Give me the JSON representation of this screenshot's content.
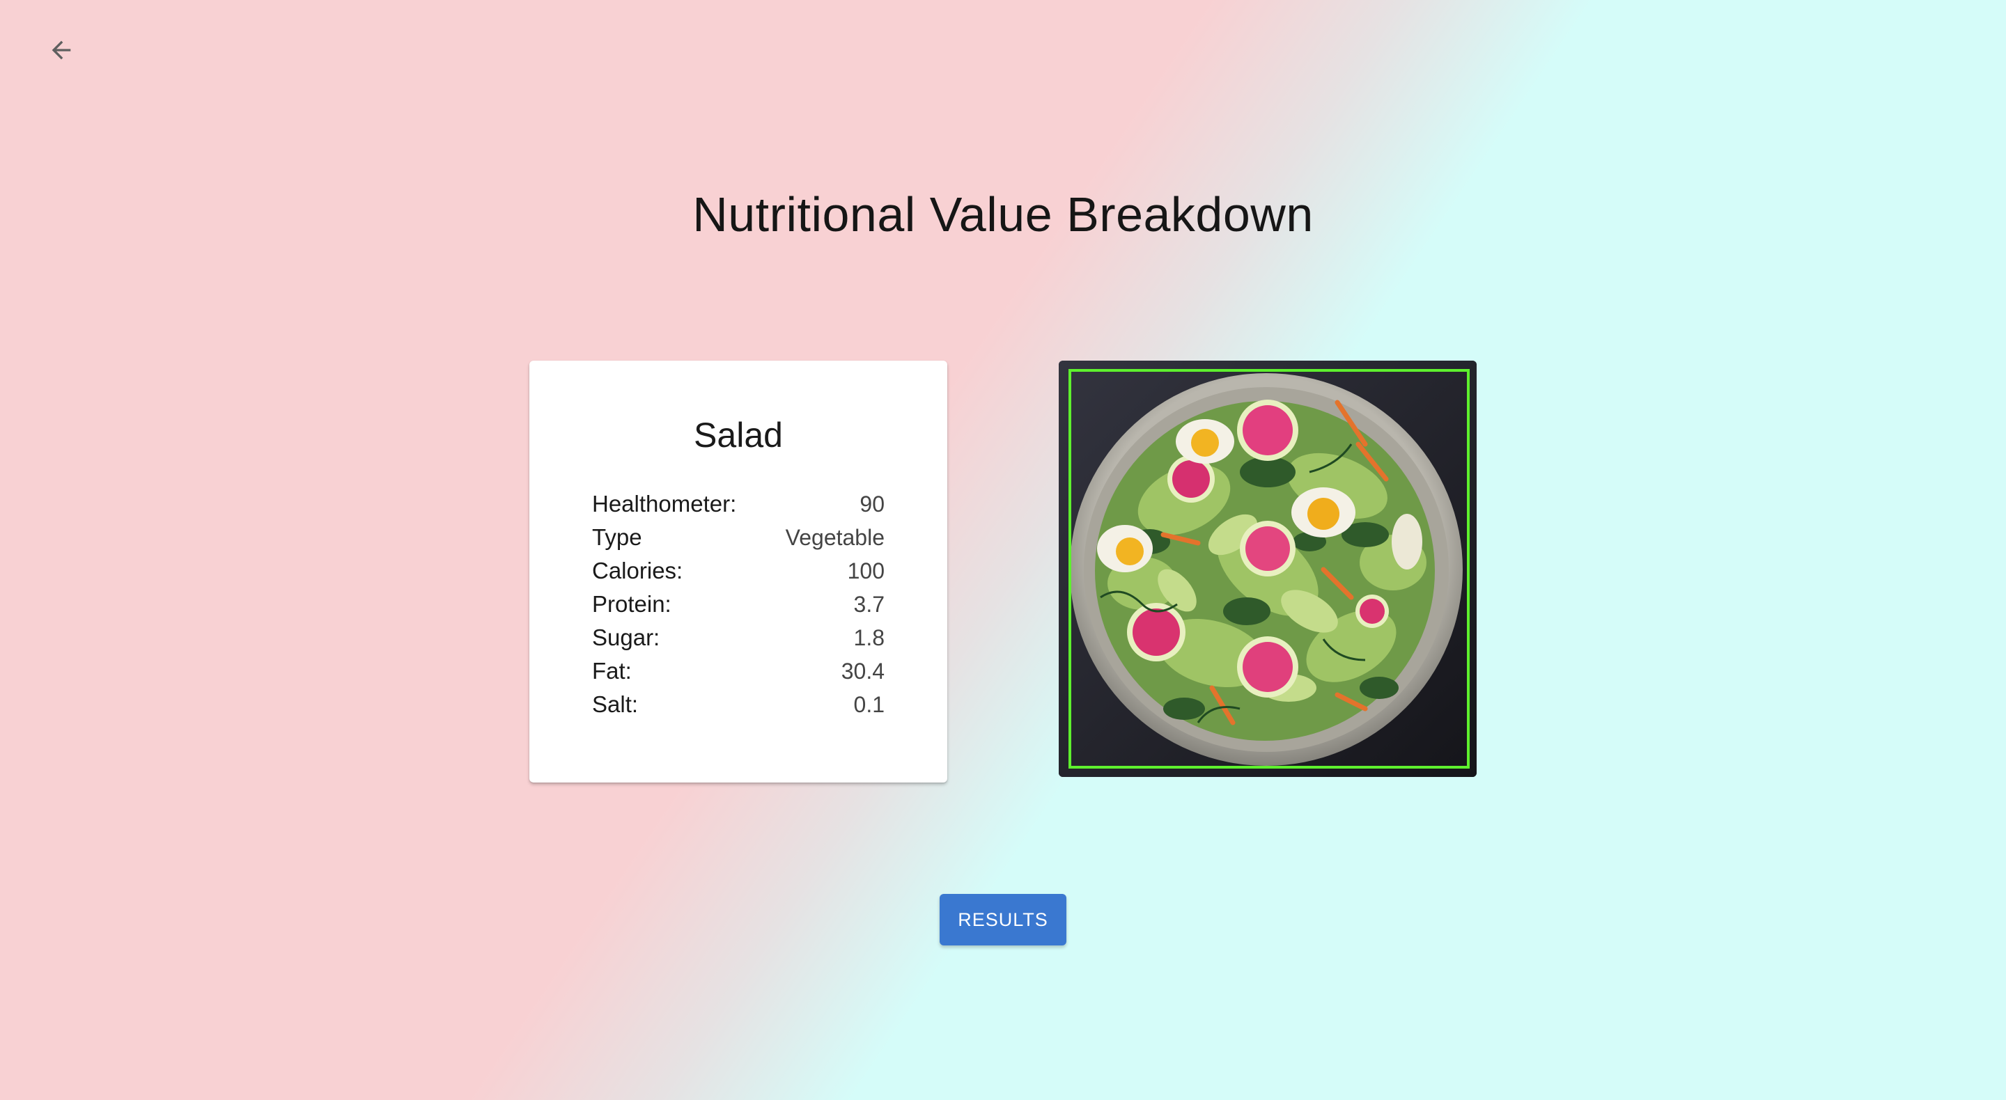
{
  "header": {
    "back_icon": "arrow-left-icon",
    "title": "Nutritional Value Breakdown"
  },
  "food_card": {
    "name": "Salad",
    "stats": [
      {
        "label": "Healthometer:",
        "value": "90"
      },
      {
        "label": "Type",
        "value": "Vegetable"
      },
      {
        "label": "Calories:",
        "value": "100"
      },
      {
        "label": "Protein:",
        "value": "3.7"
      },
      {
        "label": "Sugar:",
        "value": "1.8"
      },
      {
        "label": "Fat:",
        "value": "30.4"
      },
      {
        "label": "Salt:",
        "value": "0.1"
      }
    ]
  },
  "photo": {
    "subject": "salad-bowl-image",
    "detection_box_color": "#5ef02e"
  },
  "actions": {
    "results_label": "RESULTS"
  },
  "colors": {
    "background_pink": "#f8d1d3",
    "background_cyan": "#d5fcf9",
    "button_blue": "#3a78d0"
  }
}
